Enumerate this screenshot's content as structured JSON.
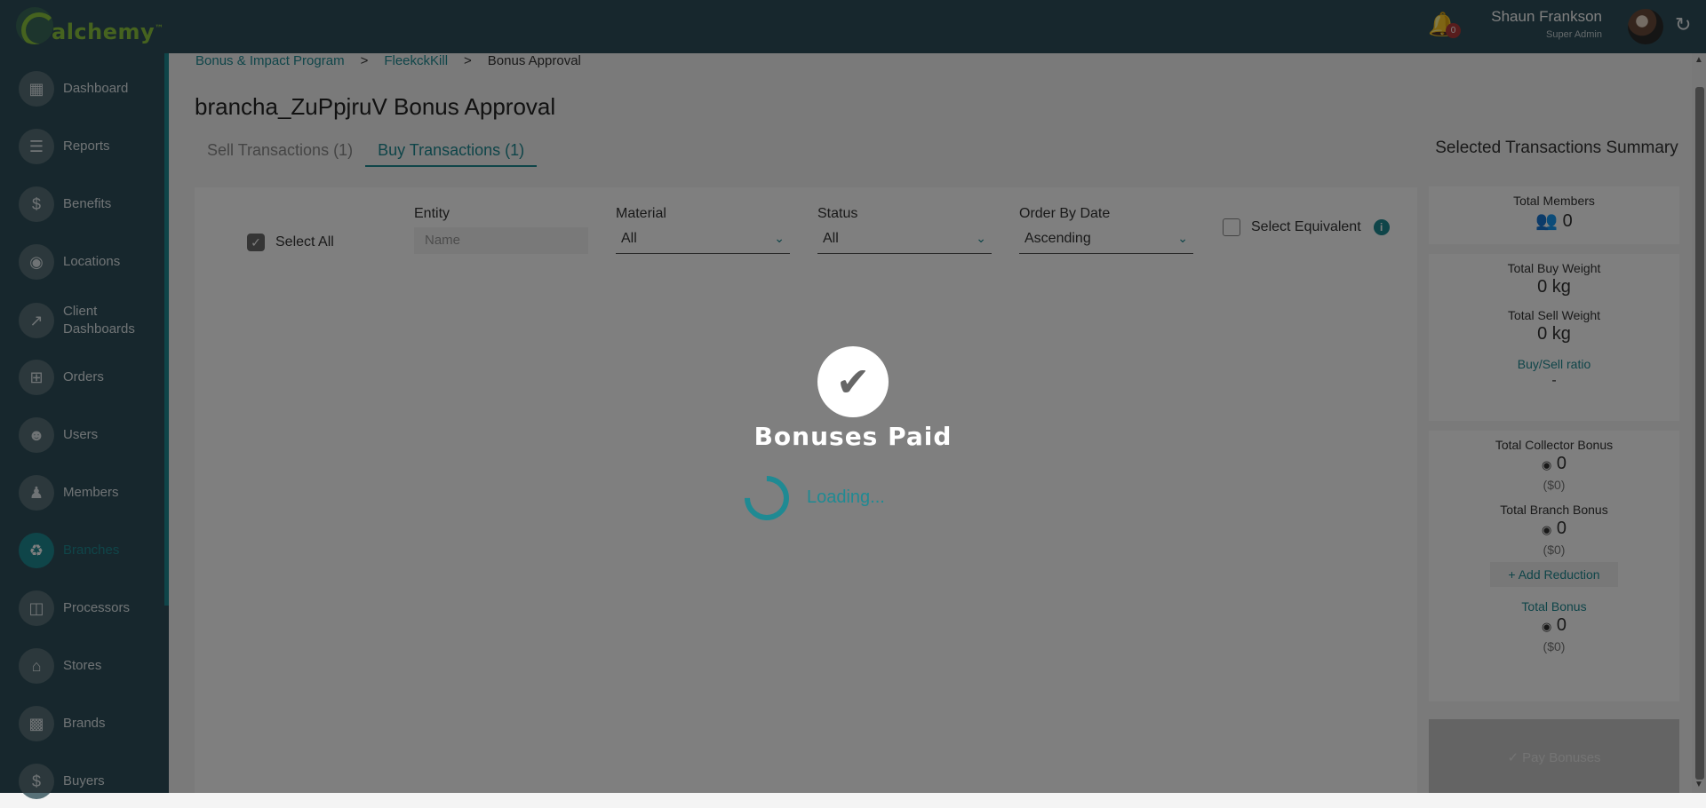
{
  "brand": {
    "name": "alchemy",
    "tm": "™"
  },
  "header": {
    "notifications_count": "0",
    "user_name": "Shaun Frankson",
    "user_role": "Super Admin"
  },
  "sidebar": {
    "items": [
      {
        "label": "Dashboard",
        "icon": "dashboard-icon"
      },
      {
        "label": "Reports",
        "icon": "list-icon"
      },
      {
        "label": "Benefits",
        "icon": "dollar-icon"
      },
      {
        "label": "Locations",
        "icon": "pin-icon"
      },
      {
        "label": "Client Dashboards",
        "icon": "chart-icon"
      },
      {
        "label": "Orders",
        "icon": "add-box-icon"
      },
      {
        "label": "Users",
        "icon": "user-face-icon"
      },
      {
        "label": "Members",
        "icon": "group-icon"
      },
      {
        "label": "Branches",
        "icon": "recycle-icon"
      },
      {
        "label": "Processors",
        "icon": "building-icon"
      },
      {
        "label": "Stores",
        "icon": "store-icon"
      },
      {
        "label": "Brands",
        "icon": "brand-icon"
      },
      {
        "label": "Buyers",
        "icon": "dollar-icon"
      }
    ]
  },
  "breadcrumb": {
    "items": [
      "Bonus & Impact Program",
      "FleekckKill",
      "Bonus Approval"
    ],
    "separator": ">"
  },
  "page": {
    "title": "brancha_ZuPpjruV Bonus Approval",
    "tabs": [
      "Sell Transactions (1)",
      "Buy Transactions (1)"
    ]
  },
  "filters": {
    "select_all": "Select All",
    "entity_label": "Entity",
    "entity_placeholder": "Name",
    "material_label": "Material",
    "material_value": "All",
    "status_label": "Status",
    "status_value": "All",
    "order_label": "Order By Date",
    "order_value": "Ascending",
    "select_equivalent": "Select Equivalent"
  },
  "summary": {
    "title": "Selected Transactions Summary",
    "total_members_label": "Total Members",
    "total_members_value": "0",
    "total_buy_weight_label": "Total Buy Weight",
    "total_buy_weight_value": "0 kg",
    "total_sell_weight_label": "Total Sell Weight",
    "total_sell_weight_value": "0 kg",
    "ratio_label": "Buy/Sell ratio",
    "ratio_value": "-",
    "collector_bonus_label": "Total Collector Bonus",
    "collector_bonus_value": "0",
    "collector_bonus_usd": "($0)",
    "branch_bonus_label": "Total Branch Bonus",
    "branch_bonus_value": "0",
    "branch_bonus_usd": "($0)",
    "add_reduction": "+ Add Reduction",
    "total_bonus_label": "Total Bonus",
    "total_bonus_value": "0",
    "total_bonus_usd": "($0)",
    "pay_button": "✓ Pay Bonuses"
  },
  "modal": {
    "title": "Bonuses Paid",
    "loading": "Loading..."
  },
  "colors": {
    "accent": "#1f8a93",
    "sidebar": "#2f4f5a",
    "brand_green": "#8cc63f"
  }
}
